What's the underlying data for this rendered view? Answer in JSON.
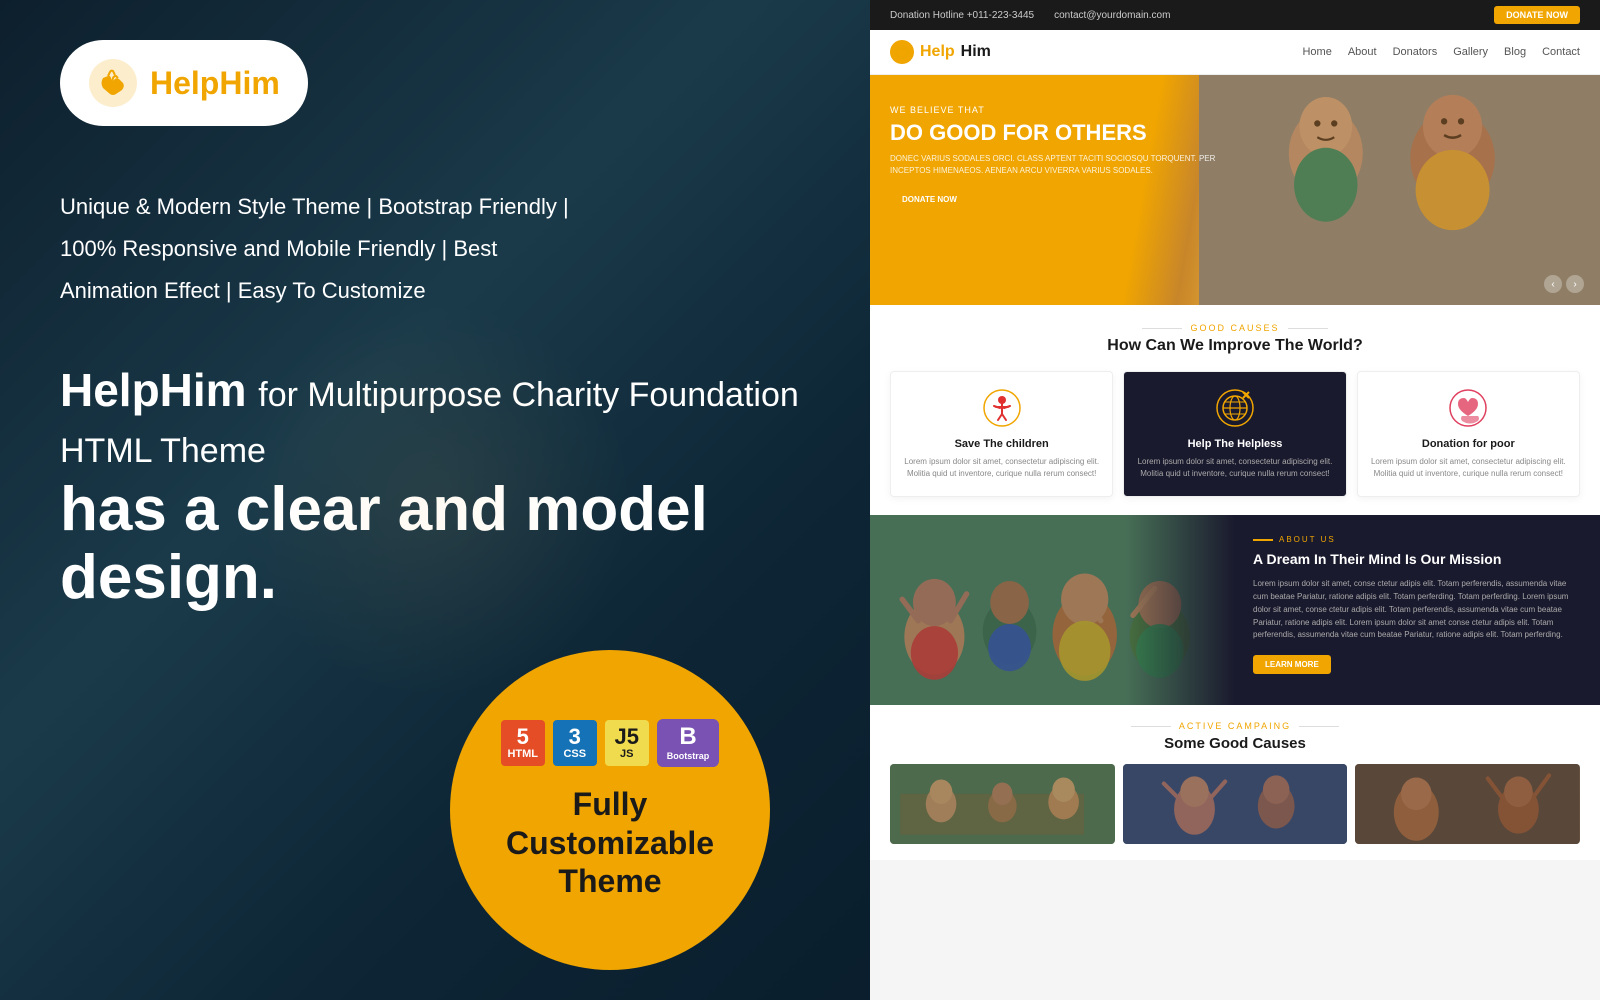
{
  "left": {
    "logo": {
      "text_help": "Help",
      "text_him": "Him",
      "alt": "HelpHim Logo"
    },
    "features": {
      "line1": "Unique & Modern Style Theme   |   Bootstrap Friendly   |",
      "line2": "100% Responsive and Mobile Friendly   |   Best",
      "line3": "Animation Effect   |   Easy To Customize"
    },
    "headline": {
      "part1_bold": "HelpHim",
      "part1_rest": " for Multipurpose Charity Foundation HTML Theme",
      "part2": "has a clear and model design."
    },
    "circle": {
      "title": "Fully\nCustomizable\nTheme",
      "html_label": "HTML",
      "html_num": "5",
      "css_label": "CSS",
      "css_num": "3",
      "js_label": "JS",
      "js_num": "J5",
      "bs_label": "Bootstrap",
      "bs_icon": "B"
    }
  },
  "right": {
    "topbar": {
      "phone": "Donation Hotline +011-223-3445",
      "email": "contact@yourdomain.com",
      "donate_btn": "DONATE NOW"
    },
    "nav": {
      "logo": "HelpHim",
      "links": [
        "Home",
        "About",
        "Donators",
        "Gallery",
        "Blog",
        "Contact"
      ]
    },
    "hero": {
      "small_label": "WE BELIEVE THAT",
      "title": "DO GOOD FOR OTHERS",
      "description": "DONEC VARIUS SODALES ORCI. CLASS APTENT TACITI SOCIOSQU TORQUENT. PER INCEPTOS HIMENAEOS. AENEAN ARCU VIVERRA VARIUS SODALES.",
      "btn": "DONATE NOW"
    },
    "causes": {
      "label": "GOOD CAUSES",
      "title": "How Can We Improve The World?",
      "cards": [
        {
          "icon": "🙏",
          "title": "Save The children",
          "desc": "Lorem ipsum dolor sit amet, consectetur adipiscing elit. Molitia quid ut inventore, curique nulla rerum consect!"
        },
        {
          "icon": "🌐",
          "title": "Help The Helpless",
          "desc": "Lorem ipsum dolor sit amet, consectetur adipiscing elit. Molitia quid ut inventore, curique nulla rerum consect!",
          "dark": true
        },
        {
          "icon": "❤️",
          "title": "Donation for poor",
          "desc": "Lorem ipsum dolor sit amet, consectetur adipiscing elit. Molitia quid ut inventore, curique nulla rerum consect!"
        }
      ]
    },
    "about": {
      "label": "ABOUT US",
      "title": "A Dream In Their Mind Is Our Mission",
      "text": "Lorem ipsum dolor sit amet, conse ctetur adipis elit. Totam perferendis, assumenda vitae cum beatae Pariatur, ratione adipis elit. Totam perferding. Totam perferding. Lorem ipsum dolor sit amet, conse ctetur adipis elit. Totam perferendis, assumenda vitae cum beatae Pariatur, ratione adipis elit. Lorem ipsum dolor sit amet conse ctetur adipis elit. Totam perferendis, assumenda vitae cum beatae Pariatur, ratione adipis elit. Totam perferding.",
      "btn": "LEARN MORE"
    },
    "campaigns": {
      "label": "ACTIVE CAMPAING",
      "title": "Some Good Causes"
    }
  }
}
